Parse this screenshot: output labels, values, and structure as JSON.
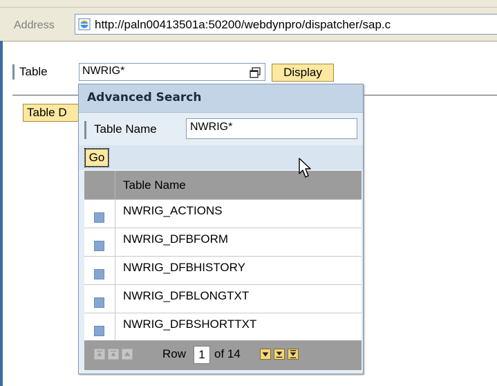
{
  "browser": {
    "address_label": "Address",
    "url": "http://paln00413501a:50200/webdynpro/dispatcher/sap.c"
  },
  "form": {
    "table_label": "Table",
    "table_value": "NWRIG*",
    "display_label": "Display",
    "table_d_label": "Table D"
  },
  "popup": {
    "title": "Advanced Search",
    "table_name_label": "Table Name",
    "table_name_value": "NWRIG*",
    "go_label": "Go",
    "column_header": "Table Name",
    "rows": [
      "NWRIG_ACTIONS",
      "NWRIG_DFBFORM",
      "NWRIG_DFBHISTORY",
      "NWRIG_DFBLONGTXT",
      "NWRIG_DFBSHORTTXT"
    ],
    "pager": {
      "row_label": "Row",
      "row_value": "1",
      "of_label": "of 14"
    }
  },
  "icons": {
    "browser_page": "ie-page-icon",
    "value_help": "value-help-icon",
    "cursor": "mouse-pointer-icon"
  },
  "colors": {
    "button_yellow": "#fce8a0",
    "popup_bg": "#e5edf5",
    "popup_title": "#c3d4e6",
    "grid_gray": "#9c9c9c",
    "row_select": "#84a6d0"
  }
}
